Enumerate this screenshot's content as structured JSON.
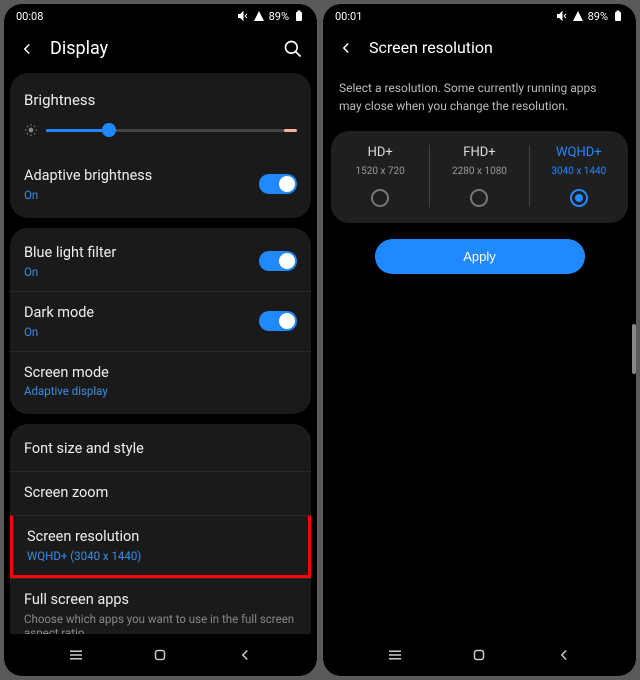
{
  "left": {
    "status": {
      "time": "00:08",
      "battery": "89%"
    },
    "title": "Display",
    "brightness_label": "Brightness",
    "toggles": {
      "adaptive": {
        "title": "Adaptive brightness",
        "status": "On"
      },
      "bluelight": {
        "title": "Blue light filter",
        "status": "On"
      },
      "dark": {
        "title": "Dark mode",
        "status": "On"
      },
      "screenmode": {
        "title": "Screen mode",
        "status": "Adaptive display"
      }
    },
    "items": {
      "font": "Font size and style",
      "zoom": "Screen zoom",
      "resolution": {
        "title": "Screen resolution",
        "status": "WQHD+ (3040 x 1440)"
      },
      "fullscreen": {
        "title": "Full screen apps",
        "desc": "Choose which apps you want to use in the full screen aspect ratio."
      }
    }
  },
  "right": {
    "status": {
      "time": "00:01",
      "battery": "89%"
    },
    "title": "Screen resolution",
    "desc": "Select a resolution. Some currently running apps may close when you change the resolution.",
    "options": [
      {
        "name": "HD+",
        "dim": "1520 x 720"
      },
      {
        "name": "FHD+",
        "dim": "2280 x 1080"
      },
      {
        "name": "WQHD+",
        "dim": "3040 x 1440"
      }
    ],
    "apply": "Apply"
  }
}
